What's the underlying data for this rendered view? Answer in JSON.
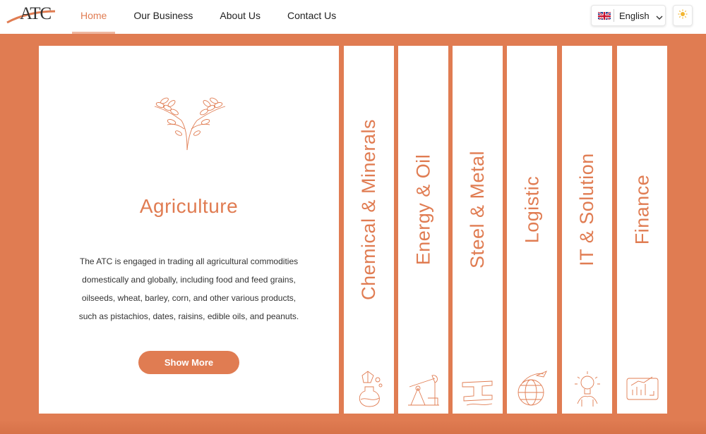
{
  "header": {
    "logo_text": "ATC",
    "nav": [
      {
        "label": "Home",
        "active": true
      },
      {
        "label": "Our Business",
        "active": false
      },
      {
        "label": "About Us",
        "active": false
      },
      {
        "label": "Contact Us",
        "active": false
      }
    ],
    "language": {
      "label": "English",
      "flag": "uk-flag-icon"
    },
    "theme_icon": "sun-icon"
  },
  "colors": {
    "accent": "#e07c52",
    "background": "#e07c52",
    "card": "#ffffff"
  },
  "featured": {
    "icon": "wheat-plant-icon",
    "title": "Agriculture",
    "description": [
      "The ATC is engaged in trading all agricultural commodities",
      "domestically and globally, including food and feed grains,",
      "oilseeds, wheat, barley, corn, and other various products,",
      "such as pistachios, dates, raisins, edible oils, and peanuts."
    ],
    "button_label": "Show More"
  },
  "sectors": [
    {
      "label": "Chemical & Minerals",
      "icon": "chemical-flask-icon"
    },
    {
      "label": "Energy & Oil",
      "icon": "oil-pump-icon"
    },
    {
      "label": "Steel & Metal",
      "icon": "steel-beam-icon"
    },
    {
      "label": "Logistic",
      "icon": "globe-plane-icon"
    },
    {
      "label": "IT & Solution",
      "icon": "lightbulb-hand-icon"
    },
    {
      "label": "Finance",
      "icon": "finance-chart-icon"
    }
  ]
}
